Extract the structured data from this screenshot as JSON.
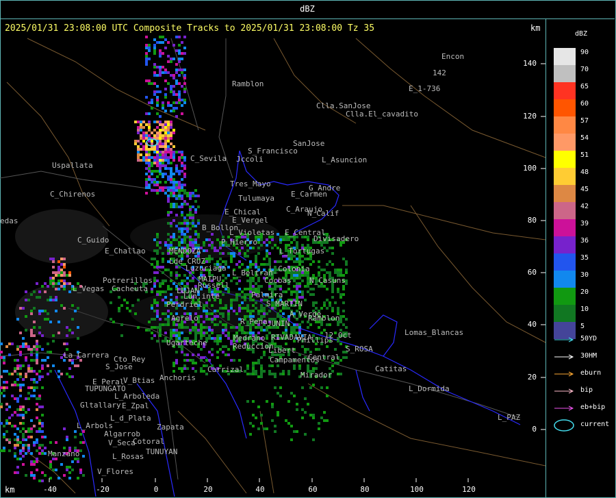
{
  "window": {
    "title": "dBZ"
  },
  "header": {
    "text": "2025/01/31 23:08:00 UTC Composite Tracks to 2025/01/31 23:08:00 Tz 35",
    "km_label": "km",
    "km_label_bottom": "km"
  },
  "axes": {
    "x_ticks": [
      "-40",
      "-20",
      "0",
      "20",
      "40",
      "60",
      "80",
      "100",
      "120"
    ],
    "y_ticks": [
      "140",
      "120",
      "100",
      "80",
      "60",
      "40",
      "20",
      "0"
    ]
  },
  "legend": {
    "title": "dBZ",
    "scale": [
      {
        "label": "90",
        "color": "#e6e6e6"
      },
      {
        "label": "70",
        "color": "#c0c0c0"
      },
      {
        "label": "65",
        "color": "#ff3322"
      },
      {
        "label": "60",
        "color": "#ff5500"
      },
      {
        "label": "57",
        "color": "#ff8844"
      },
      {
        "label": "54",
        "color": "#ff9966"
      },
      {
        "label": "51",
        "color": "#ffff00"
      },
      {
        "label": "48",
        "color": "#ffcc33"
      },
      {
        "label": "45",
        "color": "#dd8844"
      },
      {
        "label": "42",
        "color": "#cc6688"
      },
      {
        "label": "39",
        "color": "#cc1199"
      },
      {
        "label": "36",
        "color": "#7722cc"
      },
      {
        "label": "35",
        "color": "#2255ee"
      },
      {
        "label": "30",
        "color": "#1188ee"
      },
      {
        "label": "20",
        "color": "#119911"
      },
      {
        "label": "10",
        "color": "#117722"
      },
      {
        "label": "5",
        "color": "#444499"
      }
    ],
    "tracks": [
      {
        "label": "50YD",
        "color": "#44ddee"
      },
      {
        "label": "30HM",
        "color": "#ffffff"
      },
      {
        "label": "eburn",
        "color": "#ffaa33"
      },
      {
        "label": "bip",
        "color": "#ffbbcc"
      },
      {
        "label": "eb+bip",
        "color": "#ee55ee"
      },
      {
        "label": "current",
        "color": "#44ddee"
      }
    ]
  },
  "map_labels": [
    {
      "text": "Ramblon",
      "x": 339,
      "y": 126
    },
    {
      "text": "Encon",
      "x": 645,
      "y": 86
    },
    {
      "text": "E_1-736",
      "x": 597,
      "y": 133
    },
    {
      "text": "142",
      "x": 632,
      "y": 110
    },
    {
      "text": "Clla.SanJose",
      "x": 462,
      "y": 158
    },
    {
      "text": "Clla.El_cavadito",
      "x": 505,
      "y": 170
    },
    {
      "text": "SanJose",
      "x": 428,
      "y": 213
    },
    {
      "text": "S_Francisco",
      "x": 362,
      "y": 224
    },
    {
      "text": "Jccoli",
      "x": 345,
      "y": 236
    },
    {
      "text": "L_Asuncion",
      "x": 470,
      "y": 237
    },
    {
      "text": "Uspallata",
      "x": 76,
      "y": 245
    },
    {
      "text": "C_Sevila",
      "x": 278,
      "y": 235
    },
    {
      "text": "Tres_Mayo",
      "x": 336,
      "y": 272
    },
    {
      "text": "G_Andre",
      "x": 451,
      "y": 278
    },
    {
      "text": "Tulumaya",
      "x": 348,
      "y": 293
    },
    {
      "text": "E_Carmen",
      "x": 425,
      "y": 287
    },
    {
      "text": "C_Chirenos",
      "x": 73,
      "y": 287
    },
    {
      "text": "E_Chical",
      "x": 328,
      "y": 313
    },
    {
      "text": "C_Araujo",
      "x": 418,
      "y": 309
    },
    {
      "text": "N_Calif",
      "x": 449,
      "y": 315
    },
    {
      "text": "E_Vergel",
      "x": 339,
      "y": 325
    },
    {
      "text": "B_Bollon",
      "x": 295,
      "y": 336
    },
    {
      "text": "E_Central",
      "x": 416,
      "y": 343
    },
    {
      "text": "L_Violetas",
      "x": 335,
      "y": 343
    },
    {
      "text": "Divisadero",
      "x": 458,
      "y": 352
    },
    {
      "text": "C_Guido",
      "x": 113,
      "y": 354
    },
    {
      "text": "P_Hierro",
      "x": 323,
      "y": 357
    },
    {
      "text": "E_Challao",
      "x": 153,
      "y": 370
    },
    {
      "text": "MENDOZA",
      "x": 247,
      "y": 370
    },
    {
      "text": "L_Tortugas",
      "x": 408,
      "y": 370
    },
    {
      "text": "Lde_CRUZ",
      "x": 247,
      "y": 385
    },
    {
      "text": "L_Colonia",
      "x": 393,
      "y": 396
    },
    {
      "text": "Luzuriaga",
      "x": 271,
      "y": 395
    },
    {
      "text": "L_Beltran",
      "x": 339,
      "y": 402
    },
    {
      "text": "Potrerillos",
      "x": 150,
      "y": 413
    },
    {
      "text": "MAIPU",
      "x": 290,
      "y": 411
    },
    {
      "text": "Cocbas",
      "x": 386,
      "y": 413
    },
    {
      "text": "N_Casuns",
      "x": 452,
      "y": 413
    },
    {
      "text": "Cacheuta",
      "x": 163,
      "y": 425
    },
    {
      "text": "L_Vegas",
      "x": 106,
      "y": 425
    },
    {
      "text": "Russell",
      "x": 289,
      "y": 420
    },
    {
      "text": "LUJAN",
      "x": 258,
      "y": 428
    },
    {
      "text": "Palmira",
      "x": 367,
      "y": 434
    },
    {
      "text": "Lun.inte",
      "x": 268,
      "y": 436
    },
    {
      "text": "S_MARTIN",
      "x": 389,
      "y": 447
    },
    {
      "text": "Perdriel",
      "x": 243,
      "y": 448
    },
    {
      "text": "A_Verde",
      "x": 423,
      "y": 462
    },
    {
      "text": "Agrelo",
      "x": 250,
      "y": 468
    },
    {
      "text": "R_Pena",
      "x": 351,
      "y": 473
    },
    {
      "text": "JUNIN",
      "x": 390,
      "y": 476
    },
    {
      "text": "Ramblon",
      "x": 450,
      "y": 468
    },
    {
      "text": "Lomas_Blancas",
      "x": 591,
      "y": 489
    },
    {
      "text": "12_Oct",
      "x": 474,
      "y": 493
    },
    {
      "text": "Medrano",
      "x": 341,
      "y": 497
    },
    {
      "text": "RIVADAVIA",
      "x": 396,
      "y": 496
    },
    {
      "text": "Phillips",
      "x": 434,
      "y": 500
    },
    {
      "text": "Ugarteche",
      "x": 243,
      "y": 504
    },
    {
      "text": "Reduccion",
      "x": 340,
      "y": 509
    },
    {
      "text": "S_ROSA",
      "x": 505,
      "y": 513
    },
    {
      "text": "Libert",
      "x": 392,
      "y": 515
    },
    {
      "text": "La_Carrera",
      "x": 93,
      "y": 522
    },
    {
      "text": "Cto_Rey",
      "x": 166,
      "y": 528
    },
    {
      "text": "Central",
      "x": 450,
      "y": 525
    },
    {
      "text": "Campamentos",
      "x": 394,
      "y": 529
    },
    {
      "text": "S_Jose",
      "x": 154,
      "y": 539
    },
    {
      "text": "Catitas",
      "x": 548,
      "y": 542
    },
    {
      "text": "Carrizal",
      "x": 303,
      "y": 543
    },
    {
      "text": "Mirador",
      "x": 439,
      "y": 551
    },
    {
      "text": "Anchoris",
      "x": 233,
      "y": 555
    },
    {
      "text": "E_Peral",
      "x": 135,
      "y": 561
    },
    {
      "text": "V_Btias",
      "x": 180,
      "y": 559
    },
    {
      "text": "TUPUNGATO",
      "x": 124,
      "y": 571
    },
    {
      "text": "L_Dormida",
      "x": 597,
      "y": 571
    },
    {
      "text": "L_Arboleda",
      "x": 167,
      "y": 582
    },
    {
      "text": "Gltallary",
      "x": 117,
      "y": 595
    },
    {
      "text": "E_Zpal",
      "x": 178,
      "y": 596
    },
    {
      "text": "L_d_Plata",
      "x": 161,
      "y": 614
    },
    {
      "text": "L_PAZ",
      "x": 727,
      "y": 613
    },
    {
      "text": "L_Arbols",
      "x": 112,
      "y": 625
    },
    {
      "text": "Zapata",
      "x": 229,
      "y": 627
    },
    {
      "text": "Algarrob",
      "x": 152,
      "y": 637
    },
    {
      "text": "Cotoral",
      "x": 194,
      "y": 648
    },
    {
      "text": "V_Seca",
      "x": 158,
      "y": 650
    },
    {
      "text": "TUNUYAN",
      "x": 213,
      "y": 663
    },
    {
      "text": "Manzano",
      "x": 70,
      "y": 666
    },
    {
      "text": "L_Rosas",
      "x": 164,
      "y": 670
    },
    {
      "text": "V_Flores",
      "x": 142,
      "y": 692
    },
    {
      "text": "edas",
      "x": 0,
      "y": 326
    }
  ]
}
